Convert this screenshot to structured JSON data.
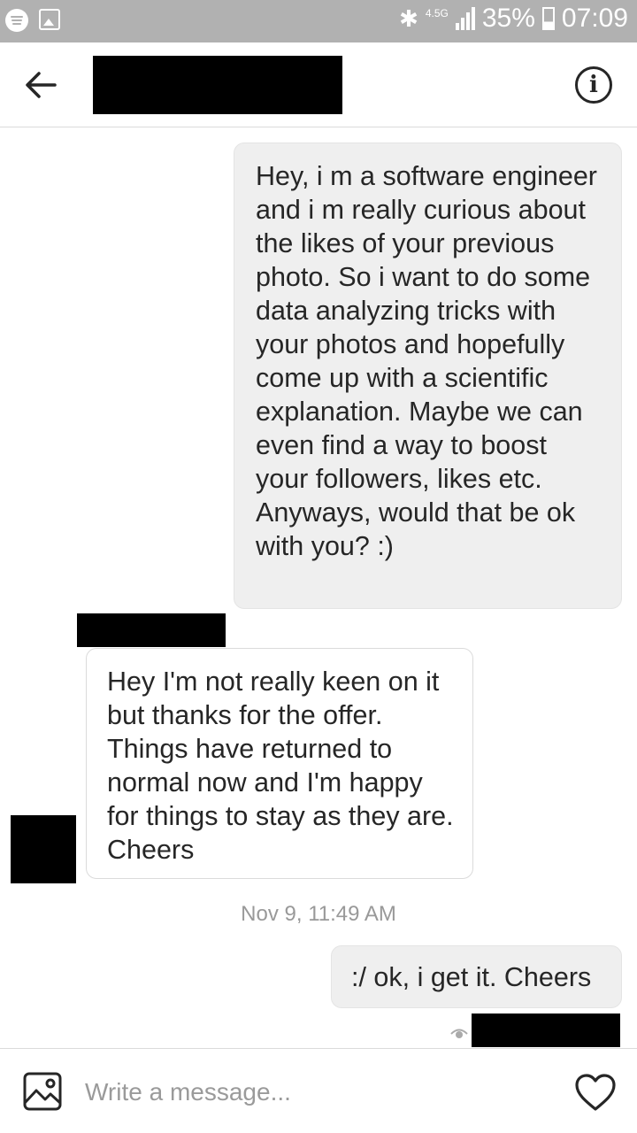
{
  "status_bar": {
    "network": "4.5G",
    "battery": "35%",
    "time": "07:09"
  },
  "header": {
    "back_icon": "arrow-left-icon",
    "info_icon": "info-circle-icon",
    "info_glyph": "i"
  },
  "messages": [
    {
      "direction": "outgoing",
      "text": "Hey, i m a software engineer and i m really curious about the likes of your previous photo. So i want to do some data analyzing tricks with your photos and hopefully come up with a scientific explanation. Maybe we can even find a way to boost your followers, likes etc. Anyways, would that be ok with you? :)"
    },
    {
      "direction": "incoming",
      "text": "Hey I'm not really keen on it but thanks for the offer. Things have returned to normal now and I'm happy for things to stay as they are. Cheers"
    },
    {
      "timestamp": "Nov 9, 11:49 AM"
    },
    {
      "direction": "outgoing",
      "text": ":/ ok, i get it. Cheers"
    }
  ],
  "composer": {
    "placeholder": "Write a message...",
    "gallery_icon": "image-icon",
    "like_icon": "heart-icon"
  },
  "colors": {
    "status_bar_bg": "#b1b1b1",
    "outgoing_bubble": "#efefef",
    "incoming_border": "#dbdbdb",
    "timestamp": "#999999",
    "redaction": "#000000"
  }
}
